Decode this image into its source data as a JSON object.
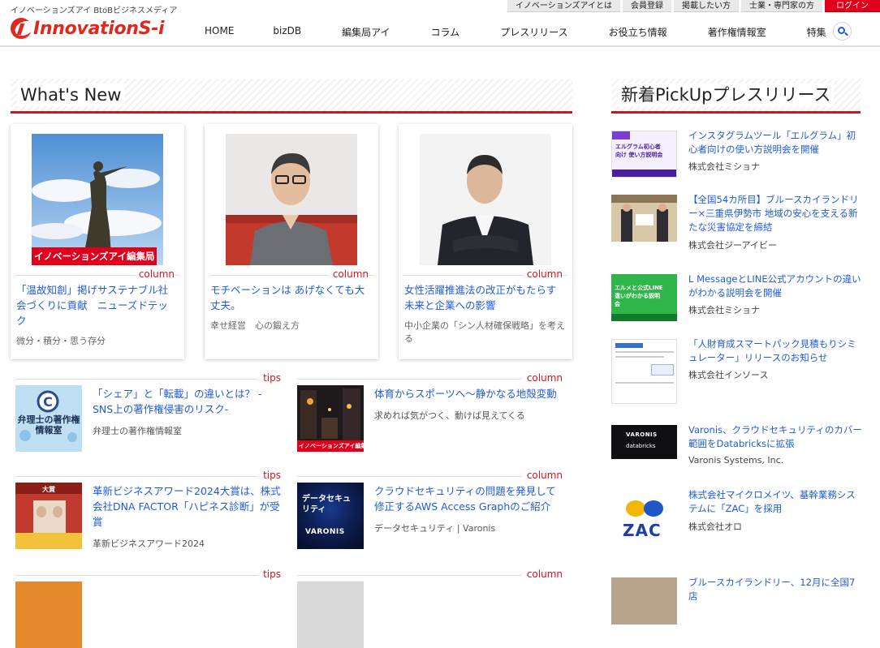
{
  "header": {
    "tagline": "イノベーションズアイ BtoBビジネスメディア",
    "logo_text": "InnovationS-i",
    "topbar": [
      {
        "label": "イノベーションズアイとは",
        "name": "topbar-about-link"
      },
      {
        "label": "会員登録",
        "name": "topbar-register-link"
      },
      {
        "label": "掲載したい方",
        "name": "topbar-post-link"
      },
      {
        "label": "士業・専門家の方",
        "name": "topbar-experts-link"
      },
      {
        "label": "ログイン",
        "name": "topbar-login-button"
      }
    ],
    "nav": [
      "HOME",
      "bizDB",
      "編集局アイ",
      "コラム",
      "プレスリリース",
      "お役立ち情報",
      "著作権情報室",
      "特集"
    ],
    "search_icon": "search-icon"
  },
  "whats_new": {
    "heading": "What's New",
    "cards": [
      {
        "category": "column",
        "title": "「温故知創」掲げサステナブル社会づくりに貢献　ニューズドテック",
        "subtitle": "微分・積分・思う存分",
        "thumb_label": "イノベーションズアイ編集局"
      },
      {
        "category": "column",
        "title": "モチベーションは あげなくても大丈夫。",
        "subtitle": "幸せ経営　心の鍛え方"
      },
      {
        "category": "column",
        "title": "女性活躍推進法の改正がもたらす未来と企業への影響",
        "subtitle": "中小企業の「シン人材確保戦略」を考える"
      }
    ],
    "items": [
      {
        "category": "tips",
        "title": "「シェア」と「転載」の違いとは？ - SNS上の著作権侵害のリスク-",
        "subtitle": "弁理士の著作権情報室",
        "thumb_text": "弁理士の著作権情報室"
      },
      {
        "category": "column",
        "title": "体育からスポーツへ〜静かなる地殻変動",
        "subtitle": "求めれば気がつく、動けば見えてくる",
        "thumb_label": "イノベーションズアイ編集局"
      },
      {
        "category": "tips",
        "title": "革新ビジネスアワード2024大賞は、株式会社DNA FACTOR「ハピネス診断」が受賞",
        "subtitle": "革新ビジネスアワード2024",
        "thumb_text": "大賞"
      },
      {
        "category": "column",
        "title": "クラウドセキュリティの問題を発見して修正するAWS Access Graphのご紹介",
        "subtitle": "データセキュリティ | Varonis",
        "thumb_text": "データセキュリティ",
        "thumb_brand": "VARONIS"
      },
      {
        "category": "tips"
      },
      {
        "category": "column"
      }
    ]
  },
  "pickup": {
    "heading": "新着PickUpプレスリリース",
    "items": [
      {
        "title": "インスタグラムツール「エルグラム」初心者向けの使い方説明会を開催",
        "company": "株式会社ミショナ",
        "thumb_text": "エルグラム初心者向け 使い方説明会"
      },
      {
        "title": "【全国54カ所目】ブルースカイランドリー×三重県伊勢市 地域の安心を支える新たな災害協定を締結",
        "company": "株式会社ジーアイビー"
      },
      {
        "title": "L MessageとLINE公式アカウントの違いがわかる説明会を開催",
        "company": "株式会社ミショナ",
        "thumb_text": "エルメと公式LINE 違いがわかる説明会"
      },
      {
        "title": "「人財育成スマートパック見積もりシミュレーター」リリースのお知らせ",
        "company": "株式会社インソース"
      },
      {
        "title": "Varonis、クラウドセキュリティのカバー範囲をDatabricksに拡張",
        "company": "Varonis Systems, Inc.",
        "thumb_text": "VARONIS",
        "thumb_text2": "databricks"
      },
      {
        "title": "株式会社マイクロメイツ、基幹業務システムに「ZAC」を採用",
        "company": "株式会社オロ",
        "thumb_text": "ZAC"
      },
      {
        "title": "ブルースカイランドリー、12月に全国7店"
      }
    ]
  },
  "colors": {
    "accent": "#d3131a",
    "link": "#1f5bd8",
    "login": "#e0001b"
  }
}
